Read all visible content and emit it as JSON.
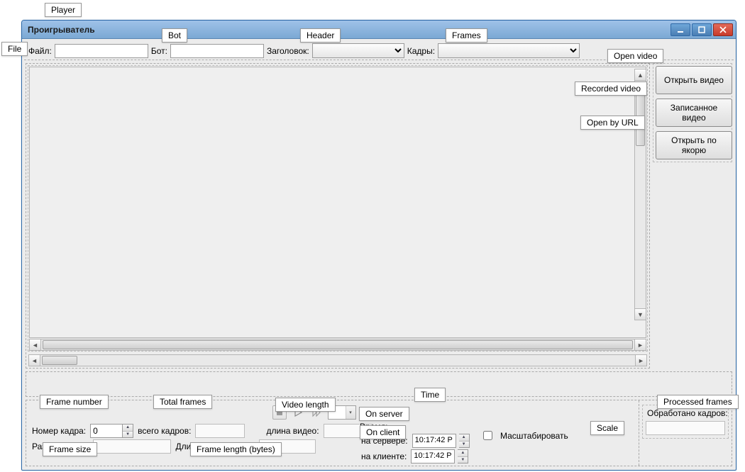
{
  "window": {
    "title": "Проигрыватель"
  },
  "top": {
    "file_label": "Файл:",
    "bot_label": "Бот:",
    "header_label": "Заголовок:",
    "frames_label": "Кадры:"
  },
  "right_buttons": {
    "open_video": "Открыть видео",
    "recorded_video": "Записанное видео",
    "open_by_url": "Открыть по якорю"
  },
  "bottom": {
    "frame_number_label": "Номер кадра:",
    "frame_number_value": "0",
    "total_frames_label": "всего кадров:",
    "video_length_label": "длина видео:",
    "frame_size_label": "Размер кадра:",
    "frame_length_bytes_label": "Длина кадра (байт):",
    "scale_label": "Масштабировать"
  },
  "time": {
    "heading": "Время:",
    "server_label": "на сервере:",
    "server_value": "10:17:42 P",
    "client_label": "на клиенте:",
    "client_value": "10:17:42 P"
  },
  "processed": {
    "label": "Обработано кадров:"
  },
  "callouts": {
    "player": "Player",
    "file": "File",
    "bot": "Bot",
    "header": "Header",
    "frames": "Frames",
    "open_video": "Open video",
    "recorded_video": "Recorded video",
    "open_by_url": "Open by URL",
    "frame_number": "Frame number",
    "total_frames": "Total frames",
    "video_length": "Video length",
    "frame_size": "Frame size",
    "frame_length_bytes": "Frame length (bytes)",
    "time": "Time",
    "on_server": "On server",
    "on_client": "On client",
    "scale": "Scale",
    "processed_frames": "Processed frames"
  }
}
